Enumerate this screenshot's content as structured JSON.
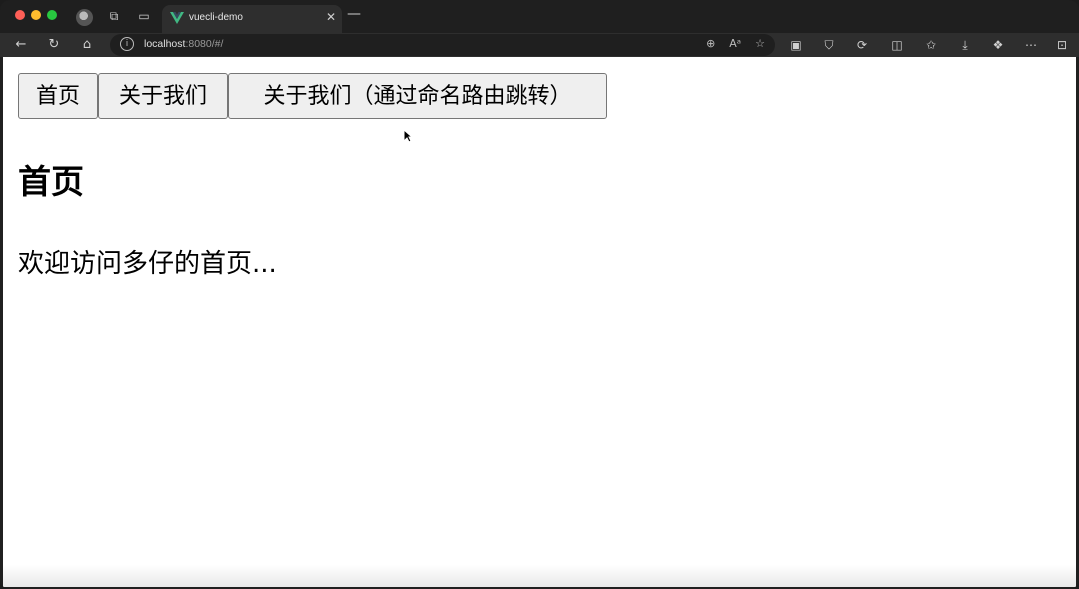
{
  "browser": {
    "tab_title": "vuecli-demo",
    "url_host": "localhost",
    "url_rest": ":8080/#/"
  },
  "page": {
    "buttons": [
      "首页",
      "关于我们",
      "关于我们（通过命名路由跳转）"
    ],
    "heading": "首页",
    "welcome": "欢迎访问多仔的首页..."
  },
  "colors": {
    "vue_green": "#41b883",
    "vue_dark": "#35495e"
  }
}
